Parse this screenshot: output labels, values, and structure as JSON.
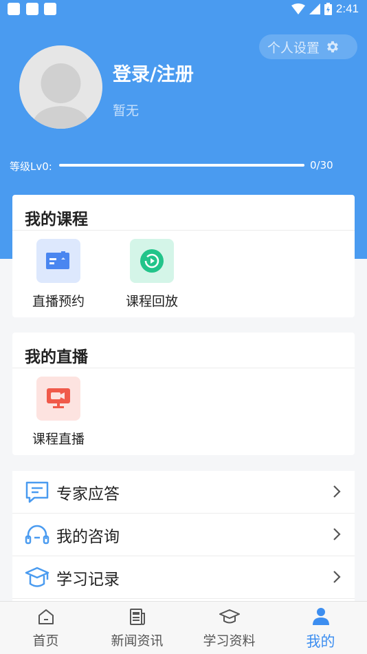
{
  "status_bar": {
    "time": "2:41",
    "icons": [
      "wifi-icon",
      "signal-icon",
      "battery-icon"
    ]
  },
  "header": {
    "settings_label": "个人设置",
    "login_title": "登录/注册",
    "subtitle": "暂无",
    "level_label": "等级Lv0:",
    "level_value": "0/30",
    "level_progress": 0
  },
  "my_courses": {
    "title": "我的课程",
    "items": [
      {
        "label": "直播预约",
        "icon": "book-icon"
      },
      {
        "label": "课程回放",
        "icon": "replay-icon"
      }
    ]
  },
  "my_live": {
    "title": "我的直播",
    "items": [
      {
        "label": "课程直播",
        "icon": "live-screen-icon"
      }
    ]
  },
  "menu": {
    "items": [
      {
        "label": "专家应答",
        "icon": "message-icon"
      },
      {
        "label": "我的咨询",
        "icon": "headset-icon"
      },
      {
        "label": "学习记录",
        "icon": "graduation-cap-icon"
      }
    ]
  },
  "tabbar": {
    "tabs": [
      {
        "label": "首页",
        "icon": "home-icon"
      },
      {
        "label": "新闻资讯",
        "icon": "news-icon"
      },
      {
        "label": "学习资料",
        "icon": "cap-icon"
      },
      {
        "label": "我的",
        "icon": "user-icon"
      }
    ],
    "active_index": 3
  },
  "colors": {
    "accent": "#4a9bf0",
    "active_tab": "#3d8ef0",
    "course_blue": "#4a86f0",
    "replay_green": "#22c48a",
    "live_red": "#f05a4a"
  }
}
